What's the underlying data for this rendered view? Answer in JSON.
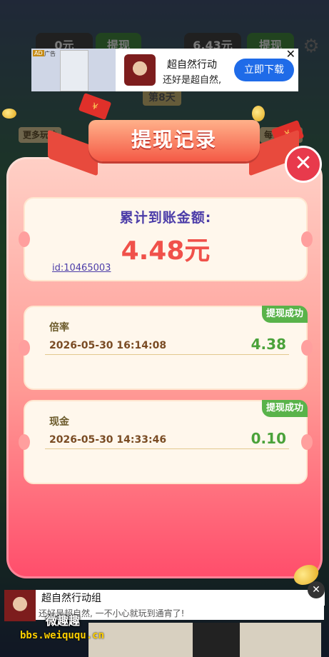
{
  "background": {
    "balance_left": "0元",
    "withdraw_left": "提现",
    "balance_right": "6.43元",
    "withdraw_right": "提现",
    "day_label": "第8天",
    "more_games": "更多玩法",
    "daily_tasks": "每日任务"
  },
  "ad_top": {
    "tag": "AD",
    "tag_text": "广告",
    "title": "超自然行动",
    "subtitle": "还好是超自然,",
    "cta": "立即下载",
    "close": "✕"
  },
  "modal": {
    "title": "提现记录",
    "close": "✕",
    "summary": {
      "label": "累计到账金额:",
      "amount": "4.48元",
      "id": "id:10465003"
    },
    "records": [
      {
        "type": "倍率",
        "time": "2026-05-30 16:14:08",
        "amount": "4.38",
        "status": "提现成功"
      },
      {
        "type": "现金",
        "time": "2026-05-30 14:33:46",
        "amount": "0.10",
        "status": "提现成功"
      }
    ]
  },
  "ad_bottom": {
    "title": "超自然行动组",
    "subtitle": "还好是超自然, 一不小心就玩到通宵了!",
    "close": "✕"
  },
  "watermark": {
    "title": "微趣趣",
    "url": "bbs.weiququ.cn"
  },
  "colors": {
    "modal_top": "#ffd0c6",
    "modal_bottom": "#ff4d6b",
    "amount_red": "#f0514a",
    "success_green": "#59b34a",
    "cta_blue": "#1f6be8"
  }
}
